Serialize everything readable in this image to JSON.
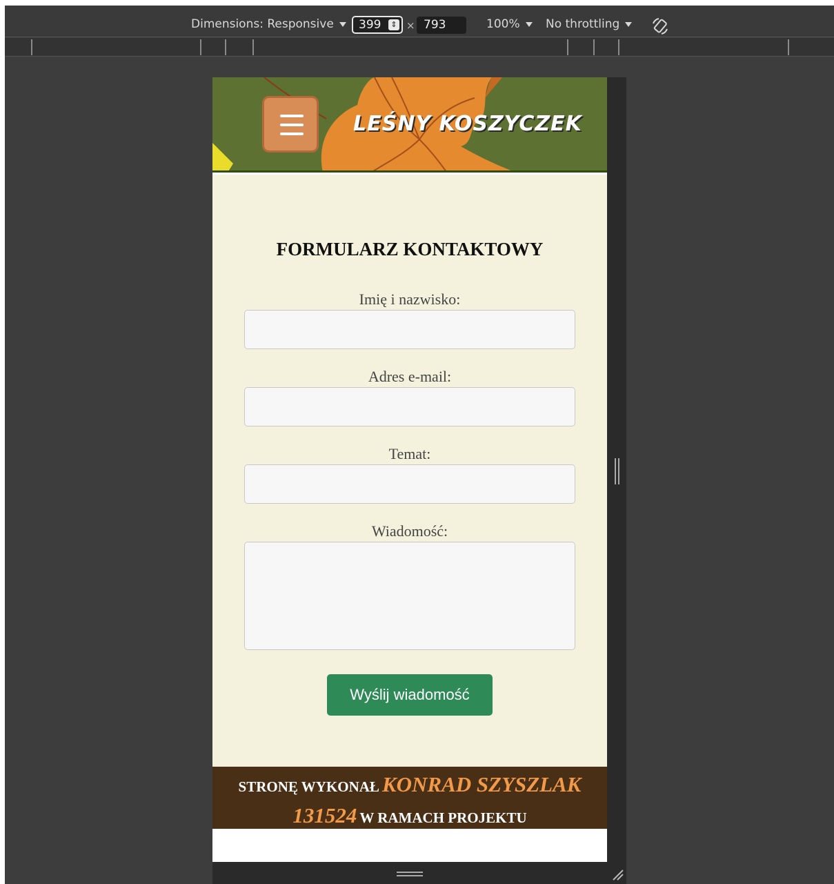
{
  "devtools": {
    "dimensions_label": "Dimensions: Responsive",
    "width_value": "399",
    "x_separator": "×",
    "height_value": "793",
    "zoom_label": "100%",
    "throttling_label": "No throttling",
    "icons": {
      "rotate": "rotate-icon",
      "spin": "spinner-arrows-icon",
      "resize": "resize-corner-icon"
    }
  },
  "site": {
    "title": "LEŚNY KOSZYCZEK",
    "menu_icon": "hamburger-icon",
    "colors": {
      "header_green": "#5c7132",
      "leaf_orange": "#e58a2e",
      "menu_button": "#d78d55",
      "content_bg": "#f4f2dc",
      "submit_green": "#2e8b57",
      "footer_brown": "#4a2f17",
      "footer_accent": "#f29a49"
    }
  },
  "form": {
    "title": "FORMULARZ KONTAKTOWY",
    "fields": [
      {
        "label": "Imię i nazwisko:",
        "value": ""
      },
      {
        "label": "Adres e-mail:",
        "value": ""
      },
      {
        "label": "Temat:",
        "value": ""
      },
      {
        "label": "Wiadomość:",
        "value": ""
      }
    ],
    "submit_label": "Wyślij wiadomość"
  },
  "footer": {
    "part1": "STRONĘ WYKONAŁ",
    "author": "KONRAD SZYSZLAK",
    "index": "131524",
    "part2": "W RAMACH PROJEKTU"
  }
}
